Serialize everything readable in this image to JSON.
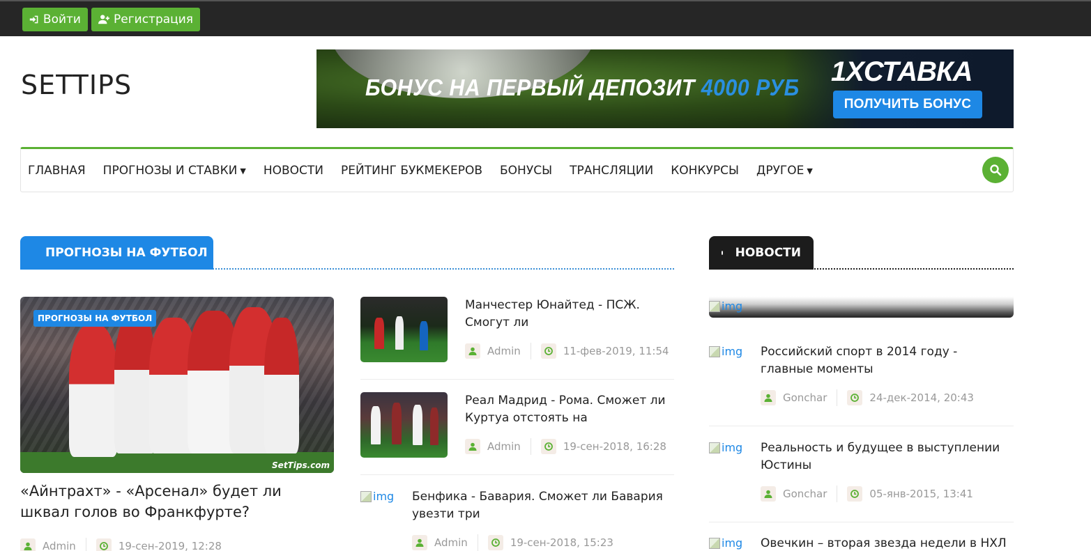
{
  "topbar": {
    "login_label": "Войти",
    "register_label": "Регистрация"
  },
  "header": {
    "logo": "SETTIPS",
    "banner": {
      "text_main": "БОНУС НА ПЕРВЫЙ ДЕПОЗИТ",
      "text_amount": "4000 РУБ",
      "brand": "1XСТАВКА",
      "button": "ПОЛУЧИТЬ БОНУС"
    }
  },
  "nav": {
    "items": [
      {
        "label": "ГЛАВНАЯ",
        "dropdown": false
      },
      {
        "label": "ПРОГНОЗЫ И СТАВКИ",
        "dropdown": true
      },
      {
        "label": "НОВОСТИ",
        "dropdown": false
      },
      {
        "label": "РЕЙТИНГ БУКМЕКЕРОВ",
        "dropdown": false
      },
      {
        "label": "БОНУСЫ",
        "dropdown": false
      },
      {
        "label": "ТРАНСЛЯЦИИ",
        "dropdown": false
      },
      {
        "label": "КОНКУРСЫ",
        "dropdown": false
      },
      {
        "label": "ДРУГОЕ",
        "dropdown": true
      }
    ],
    "search_icon": "search-icon"
  },
  "football": {
    "heading": "ПРОГНОЗЫ НА ФУТБОЛ",
    "featured": {
      "badge": "ПРОГНОЗЫ НА ФУТБОЛ",
      "watermark": "SetTips.com",
      "title": "«Айнтрахт» - «Арсенал» будет ли шквал голов во Франкфурте?",
      "author": "Admin",
      "date": "19-сен-2019, 12:28"
    },
    "items": [
      {
        "title": "Манчестер Юнайтед - ПСЖ. Смогут ли",
        "author": "Admin",
        "date": "11-фев-2019, 11:54"
      },
      {
        "title": "Реал Мадрид - Рома. Сможет ли Куртуа отстоять на",
        "author": "Admin",
        "date": "19-сен-2018, 16:28"
      },
      {
        "title": "Бенфика - Бавария. Сможет ли Бавария увезти три",
        "author": "Admin",
        "date": "19-сен-2018, 15:23",
        "img_alt": "img"
      }
    ]
  },
  "news": {
    "heading": "НОВОСТИ",
    "top_img_alt": "img",
    "items": [
      {
        "title": "Российский спорт в 2014 году - главные моменты",
        "author": "Gonchar",
        "date": "24-дек-2014, 20:43",
        "img_alt": "img"
      },
      {
        "title": "Реальность и будущее в выступлении Юстины",
        "author": "Gonchar",
        "date": "05-янв-2015, 13:41",
        "img_alt": "img"
      },
      {
        "title": "Овечкин – вторая звезда недели в НХЛ",
        "img_alt": "img"
      }
    ]
  },
  "colors": {
    "accent_green": "#5bb134",
    "accent_blue": "#1e88e5",
    "dark": "#262626"
  }
}
